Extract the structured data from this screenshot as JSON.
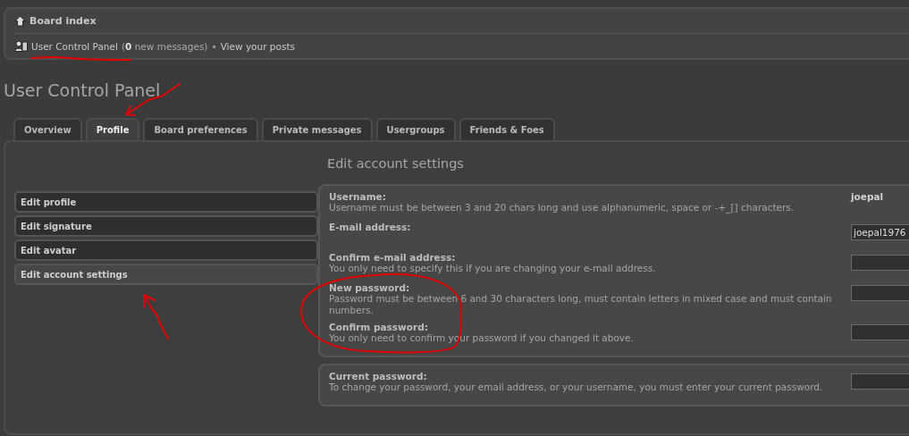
{
  "breadcrumb": {
    "label": "Board index"
  },
  "user_links": {
    "panel_link": "User Control Panel",
    "messages_note": "(**0** new messages)",
    "separator": "•",
    "posts_link": "View your posts"
  },
  "page_title": "User Control Panel",
  "tabs": [
    {
      "label": "Overview",
      "selected": false
    },
    {
      "label": "Profile",
      "selected": true
    },
    {
      "label": "Board preferences",
      "selected": false
    },
    {
      "label": "Private messages",
      "selected": false
    },
    {
      "label": "Usergroups",
      "selected": false
    },
    {
      "label": "Friends & Foes",
      "selected": false
    }
  ],
  "sidebar": {
    "items": [
      {
        "label": "Edit profile",
        "selected": false
      },
      {
        "label": "Edit signature",
        "selected": false
      },
      {
        "label": "Edit avatar",
        "selected": false
      },
      {
        "label": "Edit account settings",
        "selected": true
      }
    ]
  },
  "section_title": "Edit account settings",
  "panels": [
    {
      "fields": [
        {
          "label": "Username:",
          "explain": "Username must be between 3 and 20 chars long and use alphanumeric, space or -+_[] characters.",
          "kind": "static",
          "value": "joepal"
        },
        {
          "label": "E-mail address:",
          "kind": "input",
          "value": "joepal1976"
        },
        {
          "label": "Confirm e-mail address:",
          "explain": "You only need to specify this if you are changing your e-mail address.",
          "kind": "input"
        },
        {
          "label": "New password:",
          "explain": "Password must be between 6 and 30 characters long, must contain letters in mixed case and must contain numbers.",
          "kind": "input"
        },
        {
          "label": "Confirm password:",
          "explain": "You only need to confirm your password if you changed it above.",
          "kind": "input"
        }
      ]
    },
    {
      "fields": [
        {
          "label": "Current password:",
          "explain": "To change your password, your email address, or your username, you must enter your current password.",
          "kind": "input"
        }
      ]
    }
  ],
  "annotations": [
    {
      "kind": "underline"
    },
    {
      "kind": "arrow_tab"
    },
    {
      "kind": "arrow_menu"
    },
    {
      "kind": "circle"
    }
  ]
}
